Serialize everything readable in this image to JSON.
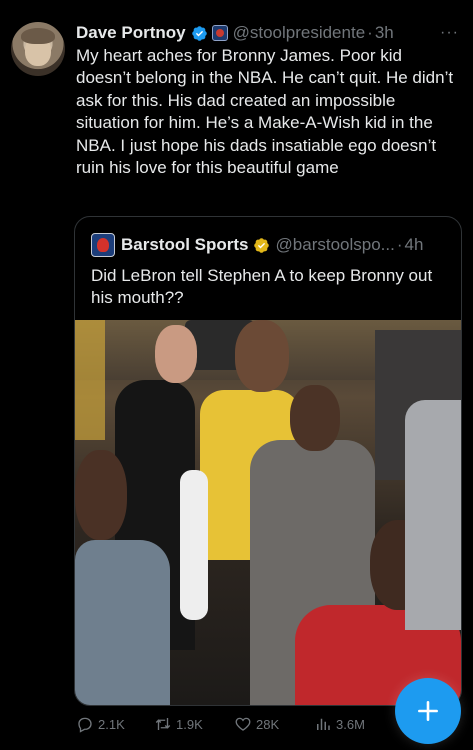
{
  "tweet": {
    "author_name": "Dave Portnoy",
    "author_handle": "@stoolpresidente",
    "separator": "·",
    "time": "3h",
    "more_label": "···",
    "text": "My heart aches for Bronny James. Poor kid doesn’t belong in the NBA. He can’t quit.  He didn’t ask for this.  His dad created an impossible situation for him.  He’s a Make-A-Wish kid in the NBA.    I just hope his dads insatiable ego doesn’t ruin his love for this beautiful game"
  },
  "quoted": {
    "author_name": "Barstool Sports",
    "author_handle": "@barstoolspo...",
    "separator": "·",
    "time": "4h",
    "text": "Did LeBron tell Stephen A to keep Bronny out his mouth??"
  },
  "actions": {
    "replies": "2.1K",
    "reposts": "1.9K",
    "likes": "28K",
    "views": "3.6M"
  },
  "icons": {
    "verified": "verified-badge-icon",
    "affiliation": "affiliate-logo-icon",
    "gold_verified": "gold-verified-badge-icon",
    "reply": "reply-icon",
    "repost": "repost-icon",
    "like": "heart-icon",
    "views": "views-icon",
    "compose": "plus-icon"
  },
  "colors": {
    "background": "#000000",
    "text": "#e7e9ea",
    "muted": "#71767b",
    "accent": "#1d9bf0",
    "gold": "#e2b719"
  }
}
